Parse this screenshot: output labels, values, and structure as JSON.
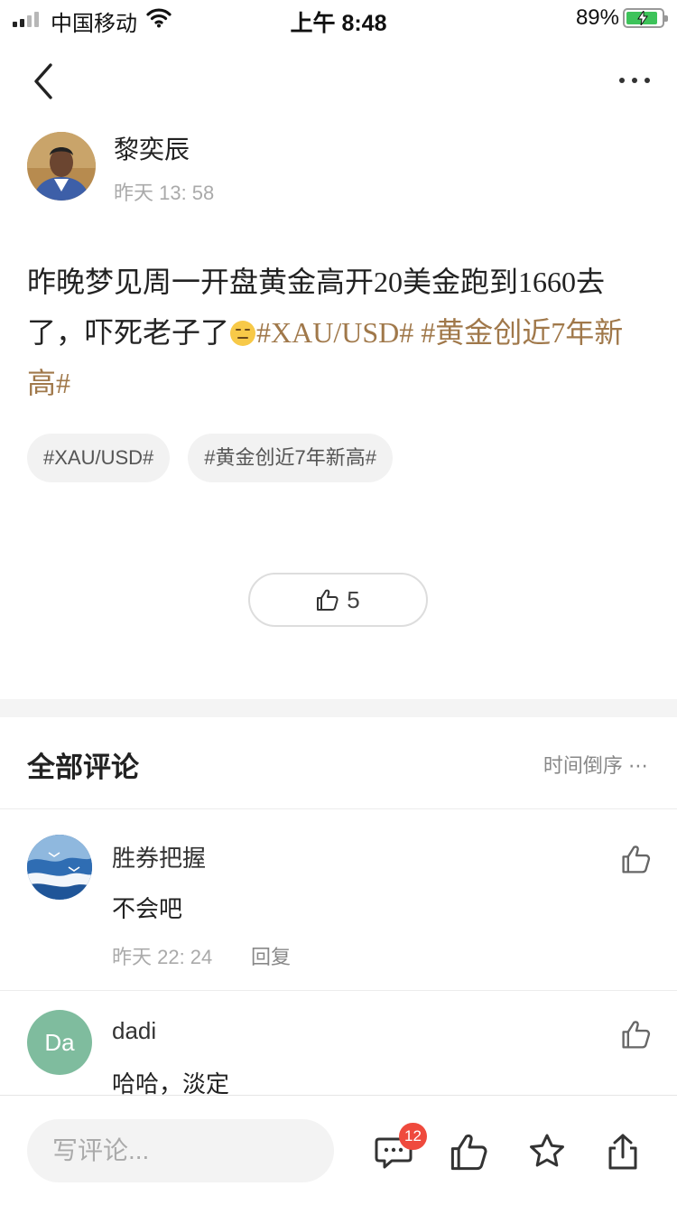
{
  "status_bar": {
    "carrier": "中国移动",
    "time": "上午 8:48",
    "battery": "89%",
    "signal_icon": "signal-bars-icon",
    "wifi_icon": "wifi-icon",
    "battery_icon": "battery-charging-icon"
  },
  "nav": {
    "back_icon": "chevron-left-icon",
    "more_icon": "more-dots-icon"
  },
  "post": {
    "author": "黎奕辰",
    "time": "昨天 13: 58",
    "text": "昨晚梦见周一开盘黄金高开20美金跑到1660去了，吓死老子了",
    "emoji": "expressionless-face-emoji",
    "inline_topics": [
      "#XAU/USD#",
      "#黄金创近7年新高#"
    ],
    "tags": [
      "#XAU/USD#",
      "#黄金创近7年新高#"
    ],
    "likes": "5",
    "topic_color": "#a0784a"
  },
  "comments_section": {
    "title": "全部评论",
    "sort_label": "时间倒序 ⋯",
    "items": [
      {
        "name": "胜券把握",
        "text": "不会吧",
        "time": "昨天 22: 24",
        "reply": "回复"
      },
      {
        "name": "dadi",
        "avatar_text": "Da",
        "text": "哈哈，淡定"
      }
    ]
  },
  "bottom_bar": {
    "input_placeholder": "写评论...",
    "comment_count": "12",
    "icons": [
      "comment-icon",
      "thumbs-up-icon",
      "star-icon",
      "share-icon"
    ],
    "badge_color": "#ef4a3d"
  }
}
